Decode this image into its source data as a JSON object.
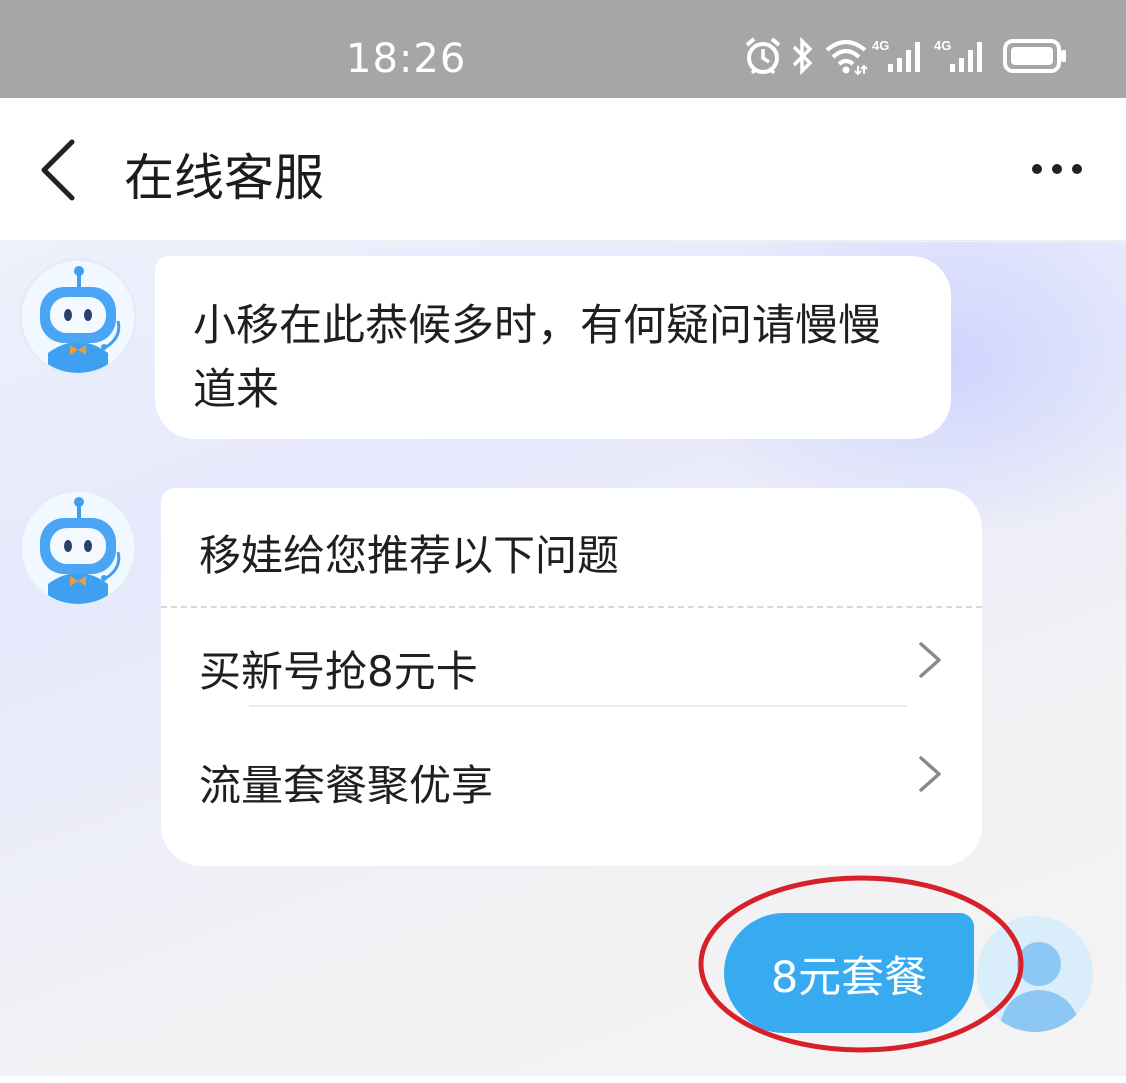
{
  "status_bar": {
    "time": "18:26",
    "icons": [
      "alarm-icon",
      "bluetooth-icon",
      "wifi-icon",
      "signal-4g-icon",
      "signal-4g-icon",
      "battery-icon"
    ],
    "network_label_1": "4G",
    "network_label_2": "4G"
  },
  "header": {
    "title": "在线客服",
    "back_icon": "chevron-left-icon",
    "more_icon": "more-dots-icon"
  },
  "chat": {
    "messages": [
      {
        "sender": "bot",
        "text": "小移在此恭候多时，有何疑问请慢慢道来"
      },
      {
        "sender": "bot",
        "title": "移娃给您推荐以下问题",
        "questions": [
          {
            "label": "买新号抢8元卡"
          },
          {
            "label": "流量套餐聚优享"
          }
        ]
      },
      {
        "sender": "user",
        "text": "8元套餐"
      }
    ]
  },
  "colors": {
    "status_bar": "#a6a6a6",
    "user_bubble": "#38aaf0",
    "annotation_circle": "#d8202a",
    "bot_avatar": "#3f9ff0"
  }
}
